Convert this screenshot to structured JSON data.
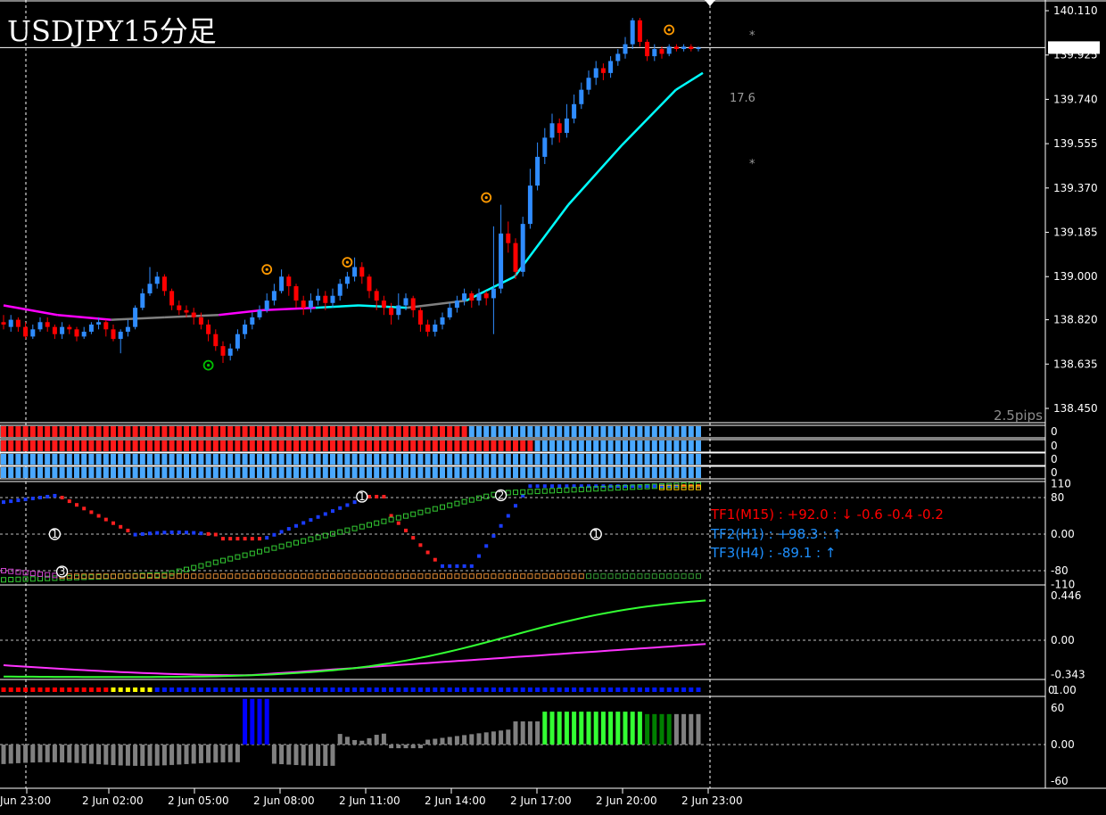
{
  "window": {
    "title": "USDJPY15分足"
  },
  "colors": {
    "background": "#000000",
    "grid": "#ffffff",
    "bull": "#2f8cff",
    "bear": "#ff0000",
    "ma_up": "#00ffff",
    "ma_flat": "#808080",
    "ma_down": "#ff00ff",
    "signal_orange": "#ff9900",
    "signal_green": "#00c000",
    "tf1": "#ff0000",
    "tf2": "#1e90ff",
    "tf3": "#1e90ff",
    "osc_green": "#33ff33",
    "osc_magenta": "#ff33ff",
    "hist_gray": "#808080",
    "hist_green": "#33ff33",
    "hist_darkgreen": "#008000",
    "hist_blue": "#0000ff"
  },
  "icons": {
    "signal": "circle-dot-icon",
    "tf_arrow_down": "arrow-down-icon",
    "tf_arrow_up": "arrow-up-icon"
  },
  "price_axis": {
    "ticks": [
      "140.110",
      "139.925",
      "139.740",
      "139.555",
      "139.370",
      "139.185",
      "139.000",
      "138.820",
      "138.635",
      "138.450"
    ],
    "current_price": "139.956",
    "pips_label": "2.5pips",
    "note_value": "17.6",
    "star": "*"
  },
  "time_axis": {
    "labels": [
      " Jun 23:00",
      "2 Jun 02:00",
      "2 Jun 05:00",
      "2 Jun 08:00",
      "2 Jun 11:00",
      "2 Jun 14:00",
      "2 Jun 17:00",
      "2 Jun 20:00",
      "2 Jun 23:00"
    ]
  },
  "bar_panels": {
    "labels": [
      "0",
      "0",
      "0",
      "0"
    ]
  },
  "mtf_panel": {
    "axis": [
      "110",
      "80",
      "0.00",
      "-80",
      "-110"
    ],
    "tf1_label": "TF1(M15) : +92.0 : ↓  -0.6 -0.4 -0.2",
    "tf2_label": "TF2(H1) : +98.3 : ↑",
    "tf3_label": "TF3(H4) : -89.1 : ↑",
    "markers": [
      "1",
      "2",
      "3",
      "1",
      "1"
    ]
  },
  "osc_panel": {
    "axis": [
      "0.446",
      "0.00",
      "-0.343"
    ]
  },
  "dot_panel": {
    "axis": [
      "1.00",
      "0"
    ]
  },
  "hist_panel": {
    "axis": [
      "60",
      "0.00",
      "-60"
    ]
  },
  "chart_data": {
    "type": "candlestick",
    "symbol": "USDJPY",
    "timeframe": "M15",
    "ylim": [
      138.45,
      140.11
    ],
    "current_price": 139.956,
    "bars": 96,
    "ma_path": [
      [
        0,
        138.88
      ],
      [
        10,
        138.84
      ],
      [
        20,
        138.82
      ],
      [
        30,
        138.83
      ],
      [
        40,
        138.84
      ],
      [
        48,
        138.86
      ],
      [
        58,
        138.87
      ],
      [
        66,
        138.88
      ],
      [
        75,
        138.87
      ],
      [
        86,
        138.9
      ],
      [
        95,
        139.0
      ],
      [
        105,
        139.3
      ],
      [
        115,
        139.55
      ],
      [
        125,
        139.78
      ],
      [
        130,
        139.85
      ]
    ],
    "candles": [
      [
        138.81,
        138.8,
        138.84,
        138.78
      ],
      [
        138.79,
        138.82,
        138.84,
        138.77
      ],
      [
        138.82,
        138.79,
        138.83,
        138.77
      ],
      [
        138.79,
        138.75,
        138.81,
        138.74
      ],
      [
        138.75,
        138.78,
        138.8,
        138.74
      ],
      [
        138.78,
        138.81,
        138.83,
        138.77
      ],
      [
        138.81,
        138.79,
        138.83,
        138.77
      ],
      [
        138.79,
        138.76,
        138.8,
        138.74
      ],
      [
        138.76,
        138.79,
        138.81,
        138.74
      ],
      [
        138.79,
        138.78,
        138.8,
        138.76
      ],
      [
        138.78,
        138.75,
        138.79,
        138.73
      ],
      [
        138.75,
        138.77,
        138.79,
        138.74
      ],
      [
        138.77,
        138.8,
        138.81,
        138.76
      ],
      [
        138.8,
        138.81,
        138.83,
        138.78
      ],
      [
        138.81,
        138.78,
        138.82,
        138.75
      ],
      [
        138.78,
        138.74,
        138.8,
        138.73
      ],
      [
        138.74,
        138.77,
        138.78,
        138.68
      ],
      [
        138.77,
        138.79,
        138.82,
        138.75
      ],
      [
        138.79,
        138.87,
        138.88,
        138.78
      ],
      [
        138.87,
        138.93,
        138.95,
        138.86
      ],
      [
        138.93,
        138.97,
        139.04,
        138.92
      ],
      [
        138.97,
        139.0,
        139.02,
        138.95
      ],
      [
        139.0,
        138.94,
        139.01,
        138.92
      ],
      [
        138.94,
        138.88,
        138.95,
        138.86
      ],
      [
        138.88,
        138.86,
        138.9,
        138.84
      ],
      [
        138.86,
        138.85,
        138.88,
        138.83
      ],
      [
        138.85,
        138.83,
        138.87,
        138.8
      ],
      [
        138.83,
        138.8,
        138.85,
        138.78
      ],
      [
        138.8,
        138.76,
        138.82,
        138.73
      ],
      [
        138.76,
        138.71,
        138.78,
        138.69
      ],
      [
        138.71,
        138.67,
        138.73,
        138.64
      ],
      [
        138.67,
        138.7,
        138.72,
        138.65
      ],
      [
        138.7,
        138.76,
        138.78,
        138.69
      ],
      [
        138.76,
        138.8,
        138.82,
        138.74
      ],
      [
        138.8,
        138.83,
        138.85,
        138.78
      ],
      [
        138.83,
        138.86,
        138.88,
        138.82
      ],
      [
        138.86,
        138.9,
        138.93,
        138.85
      ],
      [
        138.9,
        138.94,
        138.97,
        138.88
      ],
      [
        138.94,
        139.0,
        139.03,
        138.93
      ],
      [
        139.0,
        138.96,
        139.01,
        138.92
      ],
      [
        138.96,
        138.9,
        138.97,
        138.87
      ],
      [
        138.9,
        138.87,
        138.92,
        138.84
      ],
      [
        138.87,
        138.9,
        138.93,
        138.85
      ],
      [
        138.9,
        138.92,
        138.95,
        138.88
      ],
      [
        138.92,
        138.89,
        138.94,
        138.86
      ],
      [
        138.89,
        138.92,
        138.95,
        138.87
      ],
      [
        138.92,
        138.97,
        138.99,
        138.9
      ],
      [
        138.97,
        139.0,
        139.02,
        138.95
      ],
      [
        139.0,
        139.04,
        139.08,
        138.98
      ],
      [
        139.04,
        139.0,
        139.06,
        138.97
      ],
      [
        139.0,
        138.94,
        139.01,
        138.91
      ],
      [
        138.94,
        138.9,
        138.95,
        138.86
      ],
      [
        138.9,
        138.87,
        138.92,
        138.84
      ],
      [
        138.87,
        138.84,
        138.89,
        138.8
      ],
      [
        138.84,
        138.88,
        138.93,
        138.82
      ],
      [
        138.88,
        138.91,
        138.93,
        138.86
      ],
      [
        138.91,
        138.86,
        138.92,
        138.83
      ],
      [
        138.86,
        138.8,
        138.87,
        138.77
      ],
      [
        138.8,
        138.77,
        138.82,
        138.75
      ],
      [
        138.77,
        138.8,
        138.82,
        138.75
      ],
      [
        138.8,
        138.83,
        138.85,
        138.78
      ],
      [
        138.83,
        138.87,
        138.89,
        138.82
      ],
      [
        138.87,
        138.9,
        138.92,
        138.85
      ],
      [
        138.9,
        138.93,
        138.95,
        138.88
      ],
      [
        138.93,
        138.9,
        138.94,
        138.87
      ],
      [
        138.9,
        138.93,
        138.95,
        138.88
      ],
      [
        138.93,
        138.91,
        138.94,
        138.88
      ],
      [
        138.91,
        138.95,
        139.21,
        138.76
      ],
      [
        138.95,
        139.18,
        139.3,
        138.93
      ],
      [
        139.18,
        139.14,
        139.23,
        139.1
      ],
      [
        139.14,
        139.02,
        139.16,
        138.99
      ],
      [
        139.02,
        139.22,
        139.25,
        139.0
      ],
      [
        139.22,
        139.38,
        139.45,
        139.2
      ],
      [
        139.38,
        139.5,
        139.56,
        139.36
      ],
      [
        139.5,
        139.58,
        139.62,
        139.47
      ],
      [
        139.58,
        139.64,
        139.68,
        139.55
      ],
      [
        139.64,
        139.6,
        139.66,
        139.56
      ],
      [
        139.6,
        139.66,
        139.72,
        139.58
      ],
      [
        139.66,
        139.72,
        139.76,
        139.64
      ],
      [
        139.72,
        139.78,
        139.81,
        139.7
      ],
      [
        139.78,
        139.83,
        139.86,
        139.76
      ],
      [
        139.83,
        139.87,
        139.9,
        139.8
      ],
      [
        139.87,
        139.85,
        139.89,
        139.82
      ],
      [
        139.85,
        139.9,
        139.92,
        139.83
      ],
      [
        139.9,
        139.93,
        139.95,
        139.88
      ],
      [
        139.93,
        139.97,
        140.0,
        139.91
      ],
      [
        139.97,
        140.07,
        140.08,
        139.95
      ],
      [
        140.07,
        139.98,
        140.08,
        139.96
      ],
      [
        139.98,
        139.92,
        139.99,
        139.9
      ],
      [
        139.92,
        139.95,
        139.97,
        139.9
      ],
      [
        139.95,
        139.93,
        139.96,
        139.91
      ],
      [
        139.93,
        139.96,
        139.97,
        139.92
      ],
      [
        139.96,
        139.95,
        139.97,
        139.94
      ],
      [
        139.95,
        139.96,
        139.97,
        139.94
      ],
      [
        139.96,
        139.95,
        139.97,
        139.94
      ],
      [
        139.95,
        139.956,
        139.96,
        139.94
      ]
    ]
  }
}
